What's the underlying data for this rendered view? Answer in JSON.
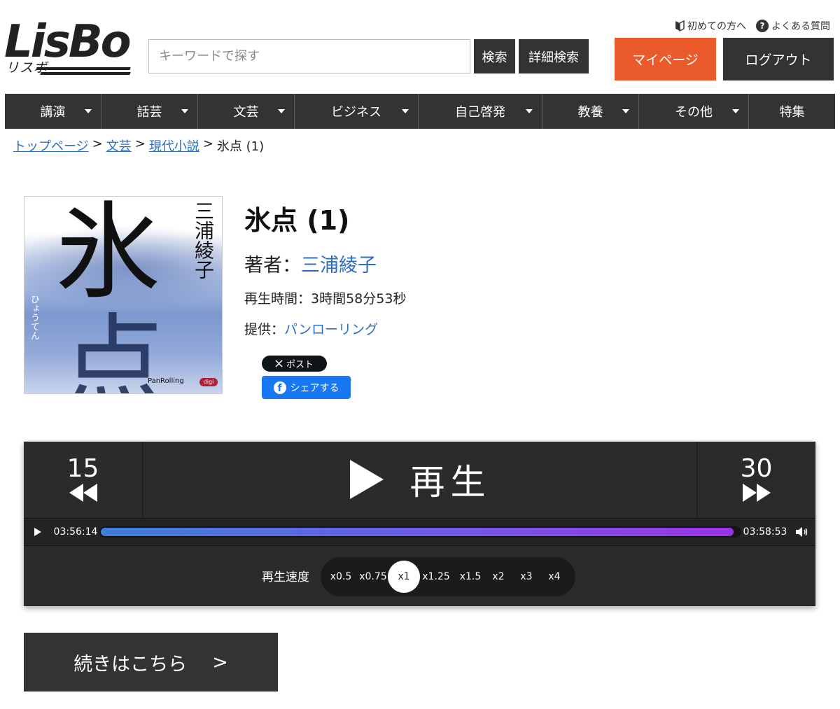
{
  "header": {
    "logo_text": "LisBo",
    "logo_sub": "リスボ",
    "search": {
      "placeholder": "キーワードで探す",
      "value": ""
    },
    "search_button": "検索",
    "advanced_search_button": "詳細検索",
    "top_links": [
      {
        "label": "初めての方へ",
        "icon": "beginner-mark-icon"
      },
      {
        "label": "よくある質問",
        "icon": "question-icon"
      }
    ],
    "mypage_button": "マイページ",
    "logout_button": "ログアウト",
    "accent_color": "#ea5a2a"
  },
  "nav": {
    "items": [
      {
        "label": "講演",
        "dropdown": true
      },
      {
        "label": "話芸",
        "dropdown": true
      },
      {
        "label": "文芸",
        "dropdown": true
      },
      {
        "label": "ビジネス",
        "dropdown": true
      },
      {
        "label": "自己啓発",
        "dropdown": true
      },
      {
        "label": "教養",
        "dropdown": true
      },
      {
        "label": "その他",
        "dropdown": true
      },
      {
        "label": "特集",
        "dropdown": false
      }
    ]
  },
  "breadcrumb": {
    "items": [
      {
        "label": "トップページ",
        "link": true
      },
      {
        "label": "文芸",
        "link": true
      },
      {
        "label": "現代小説",
        "link": true
      },
      {
        "label": "氷点 (1)",
        "link": false
      }
    ],
    "separator": ">"
  },
  "cover": {
    "title_char1": "氷",
    "title_char2": "点",
    "author": "三浦綾子",
    "reading": "ひょうてん",
    "publisher": "PanRolling",
    "badge": "digi"
  },
  "product": {
    "title": "氷点 (1)",
    "author_label": "著者：",
    "author_name": "三浦綾子",
    "duration_text": "再生時間：3時間58分53秒",
    "provider_label": "提供：",
    "provider_name": "パンローリング",
    "x_post_label": "ポスト",
    "facebook_share_label": "シェアする"
  },
  "player": {
    "skip_back_seconds": "15",
    "skip_forward_seconds": "30",
    "play_label": "再生",
    "current_time": "03:56:14",
    "total_time": "03:58:53",
    "progress_fraction": 0.99,
    "speed_label": "再生速度",
    "speeds": [
      "x0.5",
      "x0.75",
      "x1",
      "x1.25",
      "x1.5",
      "x2",
      "x3",
      "x4"
    ],
    "active_speed": "x1"
  },
  "continue_button": {
    "label": "続きはこちら",
    "arrow": ">"
  }
}
